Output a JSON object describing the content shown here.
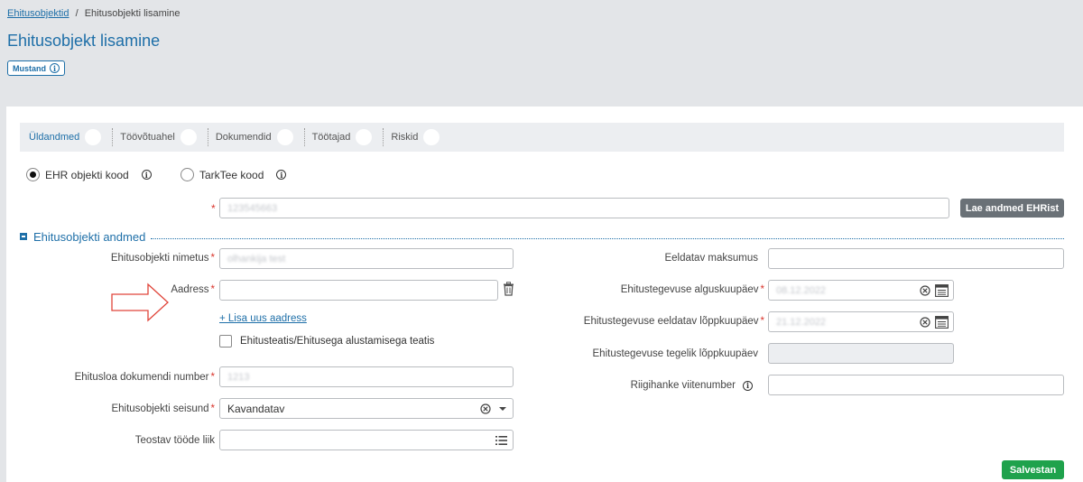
{
  "breadcrumb": {
    "parent": "Ehitusobjektid",
    "separator": "/",
    "current": "Ehitusobjekti lisamine"
  },
  "page": {
    "title": "Ehitusobjekt lisamine",
    "status": "Mustand"
  },
  "tabs": [
    {
      "label": "Üldandmed",
      "active": true
    },
    {
      "label": "Töövõtuahel"
    },
    {
      "label": "Dokumendid"
    },
    {
      "label": "Töötajad"
    },
    {
      "label": "Riskid"
    }
  ],
  "code_type": {
    "options": [
      {
        "label": "EHR objekti kood",
        "checked": true
      },
      {
        "label": "TarkTee kood",
        "checked": false
      }
    ]
  },
  "code_field": {
    "value": "123545663"
  },
  "load_button": "Lae andmed EHRist",
  "section": {
    "title": "Ehitusobjekti andmed"
  },
  "left": {
    "name": {
      "label": "Ehitusobjekti nimetus",
      "value": "olhankija test"
    },
    "address": {
      "label": "Aadress",
      "value": ""
    },
    "add_address": "+ Lisa uus aadress",
    "notice_checkbox": "Ehitusteatis/Ehitusega alustamisega teatis",
    "permit": {
      "label": "Ehitusloa dokumendi number",
      "value": "1213"
    },
    "status": {
      "label": "Ehitusobjekti seisund",
      "value": "Kavandatav"
    },
    "work_type": {
      "label": "Teostav tööde liik",
      "value": ""
    }
  },
  "right": {
    "cost": {
      "label": "Eeldatav maksumus",
      "value": ""
    },
    "start": {
      "label": "Ehitustegevuse alguskuupäev",
      "value": "08.12.2022"
    },
    "end_expected": {
      "label": "Ehitustegevuse eeldatav lõppkuupäev",
      "value": "21.12.2022"
    },
    "end_actual": {
      "label": "Ehitustegevuse tegelik lõppkuupäev",
      "value": ""
    },
    "procurement": {
      "label": "Riigihanke viitenumber",
      "value": ""
    }
  },
  "save_button": "Salvestan",
  "colors": {
    "primary": "#1e6fa8",
    "save": "#1fa24c",
    "required": "#d9342b",
    "arrow": "#e0453a"
  }
}
